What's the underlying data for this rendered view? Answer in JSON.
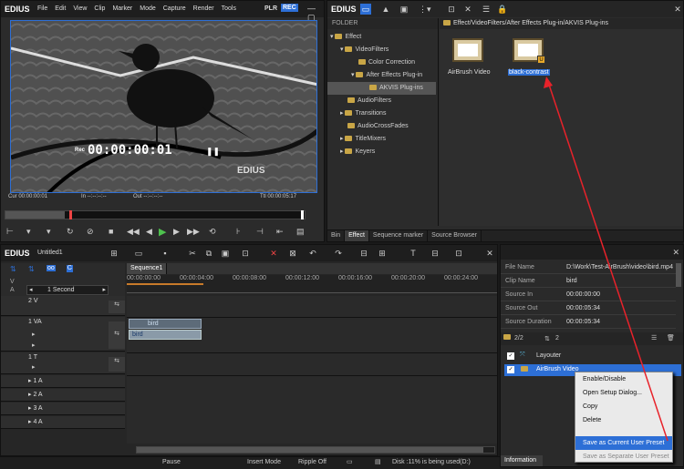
{
  "app": {
    "name": "EDIUS",
    "plr": "PLR",
    "rec": "REC"
  },
  "menu": [
    "File",
    "Edit",
    "View",
    "Clip",
    "Marker",
    "Mode",
    "Capture",
    "Render",
    "Tools"
  ],
  "player": {
    "timecode": "00:00:00:01",
    "tc_label": "Rec",
    "watermark": "EDIUS",
    "cur": "Cur 00:00:00:01",
    "in": "In --:--:--:--",
    "out": "Out --:--:--:--",
    "ttl": "Ttl 00:00:05:17"
  },
  "bin": {
    "logo": "EDIUS",
    "folder_header": "FOLDER",
    "path": "Effect/VideoFilters/After Effects Plug-in/AKVIS Plug-ins",
    "tree": [
      "Effect",
      "VideoFilters",
      "Color Correction",
      "After Effects Plug-in",
      "AKVIS Plug-ins",
      "AudioFilters",
      "Transitions",
      "AudioCrossFades",
      "TitleMixers",
      "Keyers"
    ],
    "items": [
      "AirBrush Video",
      "black-contrast"
    ],
    "tabs": [
      "Bin",
      "Effect",
      "Sequence marker",
      "Source Browser"
    ]
  },
  "timeline": {
    "logo": "EDIUS",
    "project": "Untitled1",
    "sequence_tab": "Sequence1",
    "scale": "1 Second",
    "ruler": [
      "00:00:00:00",
      "00:00:04:00",
      "00:00:08:00",
      "00:00:12:00",
      "00:00:16:00",
      "00:00:20:00",
      "00:00:24:00"
    ],
    "tracks": [
      "2 V",
      "1 VA",
      "1 T",
      "1 A",
      "2 A",
      "3 A",
      "4 A"
    ],
    "clip_name": "bird",
    "header_v": "V",
    "header_a": "A"
  },
  "info": {
    "rows": [
      [
        "File Name",
        "D:\\Work\\Test-AirBrush\\video\\bird.mp4"
      ],
      [
        "Clip Name",
        "bird"
      ],
      [
        "Source In",
        "00:00:00:00"
      ],
      [
        "Source Out",
        "00:00:05:34"
      ],
      [
        "Source Duration",
        "00:00:05:34"
      ]
    ],
    "count_a": "2/2",
    "count_b": "2",
    "filters": [
      "Layouter",
      "AirBrush Video"
    ],
    "tab": "Information"
  },
  "context_menu": [
    "Enable/Disable",
    "Open Setup Dialog...",
    "Copy",
    "Delete",
    "Save as Current User Preset",
    "Save as Separate User Preset"
  ],
  "status": {
    "mode": "Pause",
    "insert": "Insert Mode",
    "ripple": "Ripple Off",
    "disk": "Disk :11% is being used(D:)"
  },
  "colors": {
    "accent": "#2d6fd6",
    "arrow": "#e8222a",
    "rec": "#2d6fd6"
  }
}
